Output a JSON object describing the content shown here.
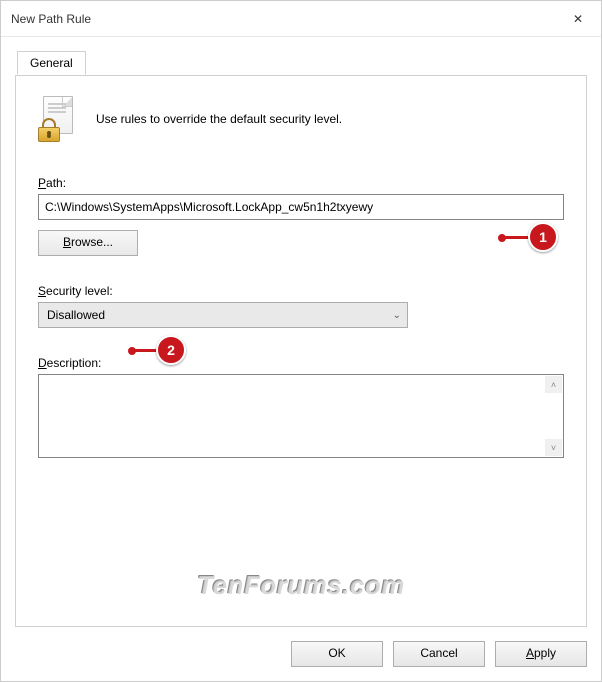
{
  "window": {
    "title": "New Path Rule"
  },
  "tab": {
    "label": "General"
  },
  "header": {
    "description": "Use rules to override the default security level."
  },
  "path": {
    "label": "Path:",
    "value": "C:\\Windows\\SystemApps\\Microsoft.LockApp_cw5n1h2txyewy",
    "browse_label": "Browse..."
  },
  "security": {
    "label": "Security level:",
    "value": "Disallowed"
  },
  "description": {
    "label": "Description:",
    "value": ""
  },
  "buttons": {
    "ok": "OK",
    "cancel": "Cancel",
    "apply": "Apply"
  },
  "annotations": {
    "a1": "1",
    "a2": "2"
  },
  "watermark": "TenForums.com"
}
